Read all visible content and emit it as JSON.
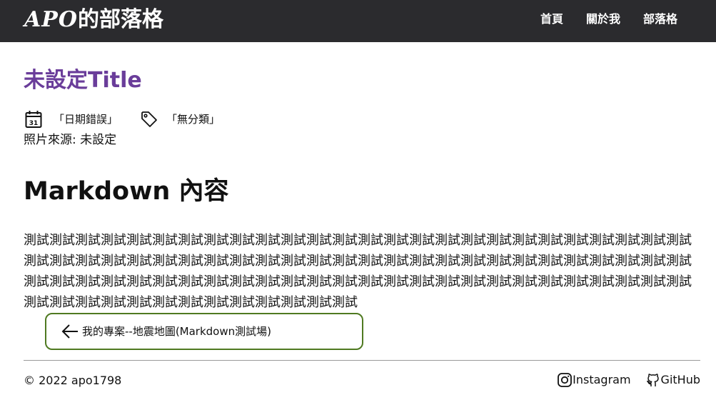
{
  "header": {
    "brand_latin": "APO",
    "brand_cjk": "的部落格",
    "nav": [
      {
        "label": "首頁"
      },
      {
        "label": "關於我"
      },
      {
        "label": "部落格"
      }
    ]
  },
  "post": {
    "title": "未設定Title",
    "date": "「日期錯誤」",
    "date_icon_day": "31",
    "category": "「無分類」",
    "photo_source": "照片來源: 未設定"
  },
  "content": {
    "heading": "Markdown 內容",
    "body": "測試測試測試測試測試測試測試測試測試測試測試測試測試測試測試測試測試測試測試測試測試測試測試測試測試測試測試測試測試測試測試測試測試測試測試測試測試測試測試測試測試測試測試測試測試測試測試測試測試測試測試測試測試測試測試測試測試測試測試測試測試測試測試測試測試測試測試測試測試測試測試測試測試測試測試測試測試測試測試測試測試測試測試測試測試測試測試測試測試測試測試"
  },
  "navigation": {
    "prev_label": "我的專案--地震地圖(Markdown測試場)"
  },
  "footer": {
    "copyright": "© 2022 apo1798",
    "links": [
      {
        "label": "Instagram",
        "icon": "instagram-icon"
      },
      {
        "label": "GitHub",
        "icon": "github-icon"
      }
    ]
  },
  "colors": {
    "header_bg": "#2b2b2e",
    "title": "#6a3d9a",
    "button_border": "#4f7a21"
  }
}
